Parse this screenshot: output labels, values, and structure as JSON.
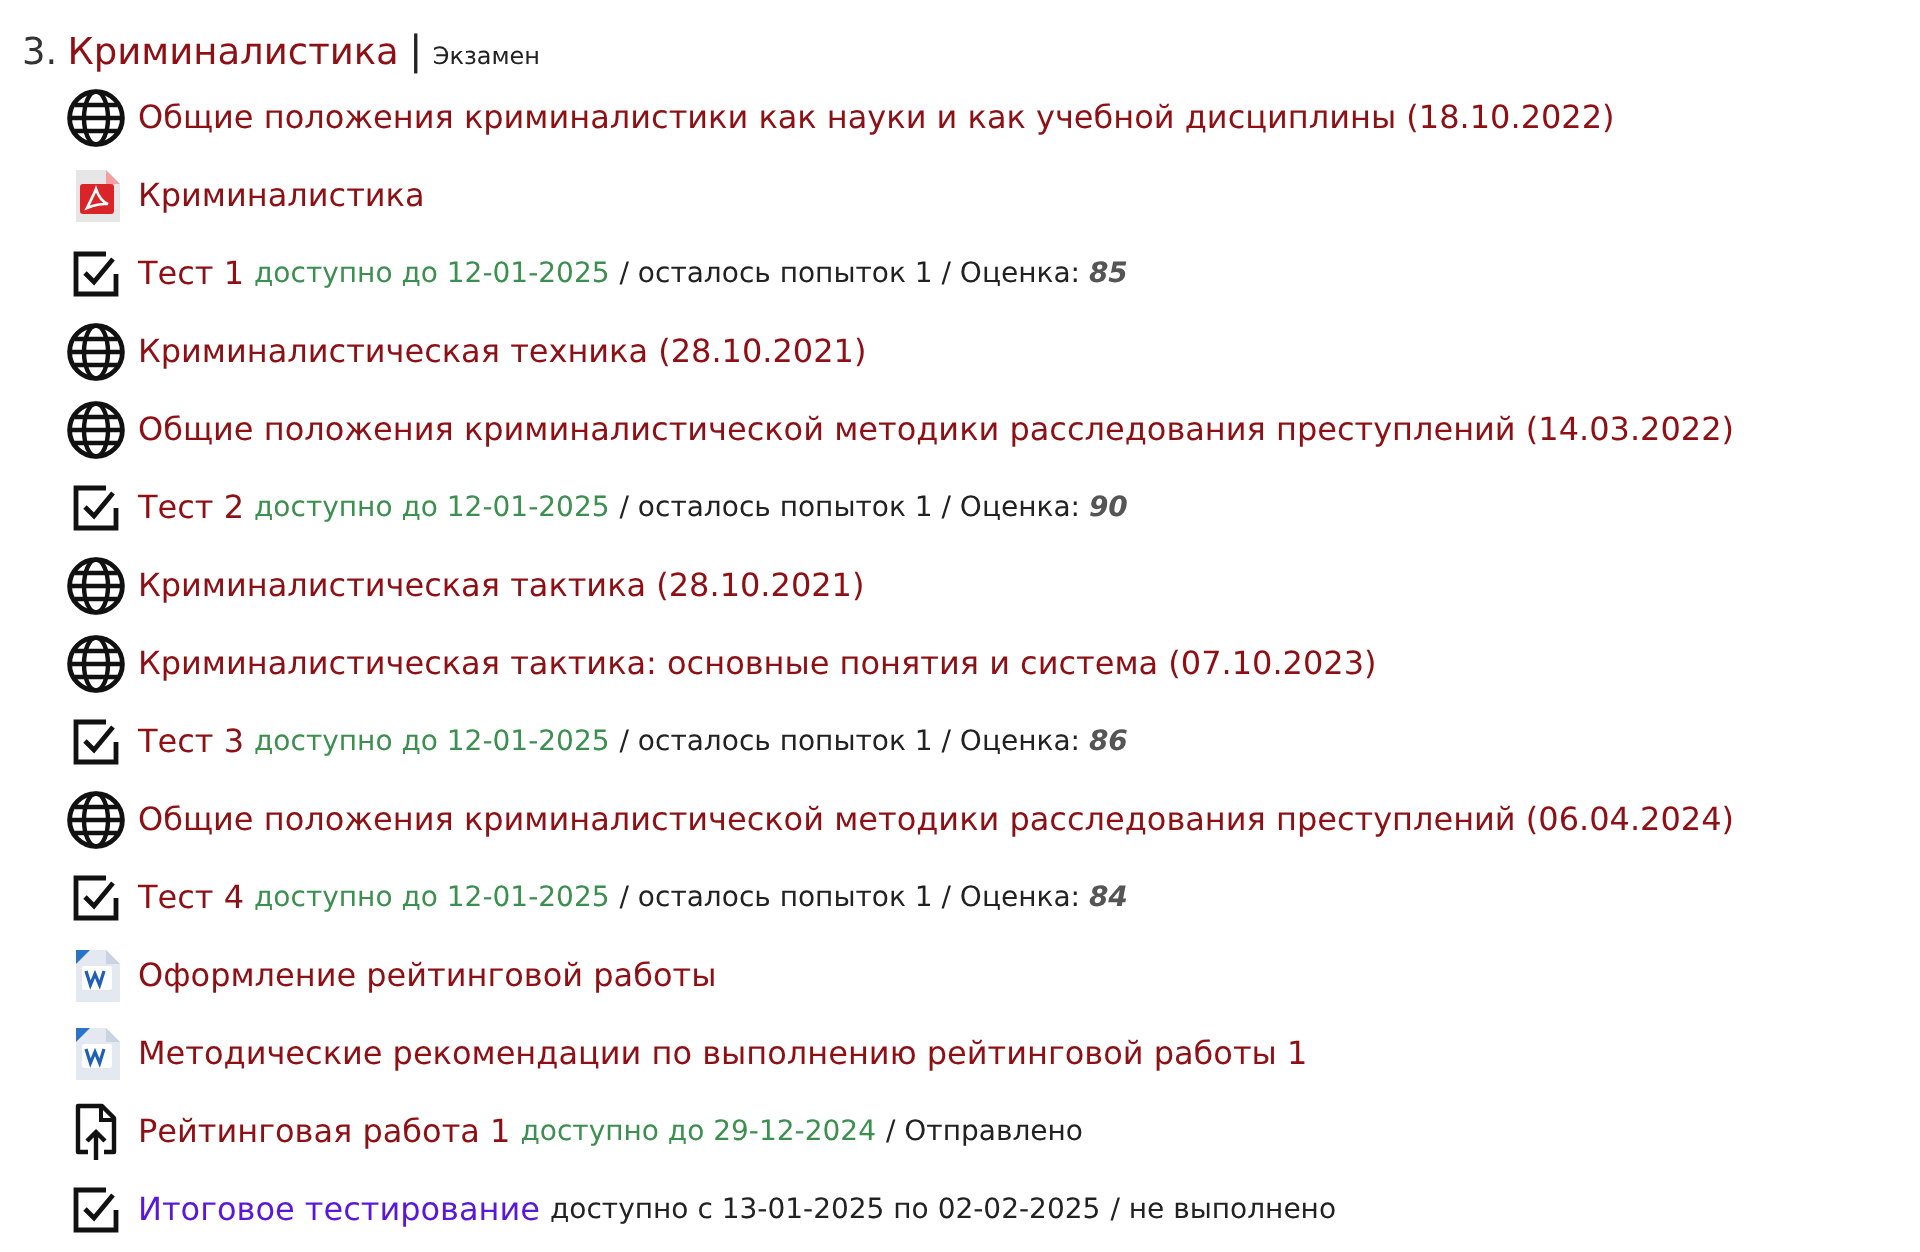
{
  "section": {
    "number": "3.",
    "title": "Криминалистика",
    "separator": "|",
    "type": "Экзамен"
  },
  "items": [
    {
      "kind": "url",
      "title": "Общие положения криминалистики как науки и как учебной дисциплины (18.10.2022)",
      "visited": false
    },
    {
      "kind": "pdf",
      "title": "Криминалистика",
      "visited": false
    },
    {
      "kind": "quiz",
      "title": "Тест 1",
      "visited": false,
      "availability": "доступно до 12-01-2025",
      "available": true,
      "details": "/ осталось попыток 1 / Оценка: **85**"
    },
    {
      "kind": "url",
      "title": "Криминалистическая техника (28.10.2021)",
      "visited": false
    },
    {
      "kind": "url",
      "title": "Общие положения криминалистической методики расследования преступлений (14.03.2022)",
      "visited": false
    },
    {
      "kind": "quiz",
      "title": "Тест 2",
      "visited": false,
      "availability": "доступно до 12-01-2025",
      "available": true,
      "details": "/ осталось попыток 1 / Оценка: **90**"
    },
    {
      "kind": "url",
      "title": "Криминалистическая тактика (28.10.2021)",
      "visited": false
    },
    {
      "kind": "url",
      "title": "Криминалистическая тактика: основные понятия и система (07.10.2023)",
      "visited": false
    },
    {
      "kind": "quiz",
      "title": "Тест 3",
      "visited": false,
      "availability": "доступно до 12-01-2025",
      "available": true,
      "details": "/ осталось попыток 1 / Оценка: **86**"
    },
    {
      "kind": "url",
      "title": "Общие положения криминалистической методики расследования преступлений (06.04.2024)",
      "visited": false
    },
    {
      "kind": "quiz",
      "title": "Тест 4",
      "visited": false,
      "availability": "доступно до 12-01-2025",
      "available": true,
      "details": "/ осталось попыток 1 / Оценка: **84**"
    },
    {
      "kind": "doc",
      "title": "Оформление рейтинговой работы",
      "visited": false
    },
    {
      "kind": "doc",
      "title": "Методические рекомендации по выполнению рейтинговой работы 1",
      "visited": false
    },
    {
      "kind": "assign",
      "title": "Рейтинговая работа 1",
      "visited": false,
      "availability": "доступно до 29-12-2024",
      "available": true,
      "details": "/ Отправлено"
    },
    {
      "kind": "quiz",
      "title": "Итоговое тестирование",
      "visited": true,
      "availability": "доступно с 13-01-2025 по 02-02-2025",
      "available": false,
      "details": "/ не выполнено"
    }
  ]
}
